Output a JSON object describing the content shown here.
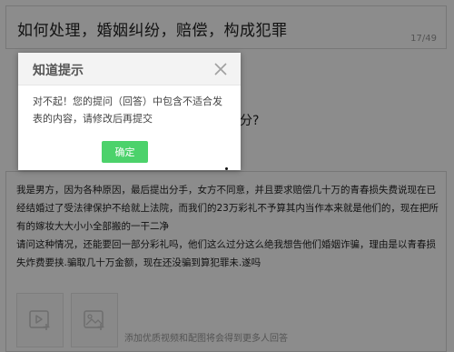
{
  "title_field": {
    "value": "如何处理，婚姻纠纷，赔偿，构成犯罪",
    "counter": "17/49"
  },
  "question_hint_partial": "划分?",
  "description": {
    "text": "我是男方，因为各种原因，最后提出分手，女方不同意，并且要求赔偿几十万的青春损失费说现在已经结婚过了受法律保护不给就上法院，而我们的23万彩礼不予算其内当作本来就是他们的，现在把所有的嫁妆大大小小全部搬的一干二净\n请问这种情况，还能要回一部分彩礼吗，他们这么过分这么绝我想告他们婚姻诈骗，理由是以青春损失炸费要挟.骗取几十万金额，现在还没骗到算犯罪未.遂吗",
    "upload_hint": "添加优质视频和配图将会得到更多人回答"
  },
  "icons": {
    "add_video": "video-add-icon",
    "add_image": "image-add-icon",
    "close": "close-icon"
  },
  "modal": {
    "title": "知道提示",
    "message": "对不起！您的提问（回答）中包含不适合发表的内容，请修改后再提交",
    "ok_label": "确定"
  },
  "colors": {
    "ok_button": "#4cd26b",
    "overlay": "rgba(0,0,0,0.45)"
  }
}
